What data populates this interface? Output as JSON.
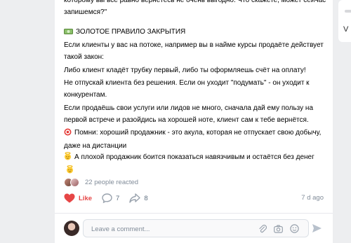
{
  "post": {
    "lines": [
      "которому вы всё равно вернётесь не очень выгодно. Что скажете, может сейчас запишемся?\"",
      "ЗОЛОТОЕ ПРАВИЛО ЗАКРЫТИЯ",
      "Если клиенты у вас на потоке, например вы в найме курсы продаёте действует такой закон:",
      "Либо клиент кладёт трубку первый, либо ты оформляешь счёт на оплату!",
      "Не отпускай клиента без решения. Если он уходит \"подумать\" - он уходит к конкурентам.",
      "Если продаёшь свои услуги или лидов не много, сначала дай ему пользу на первой встрече и разойдись на хорошей ноте, клиент сам к тебе вернётся.",
      "Помни: хороший продажник - это акула, которая не отпускает свою добычу, даже на дистанции",
      "А плохой продажник боится показаться навязчивым и остаётся без денег"
    ],
    "icons": [
      "money-icon",
      "target-icon",
      "angel-icon"
    ]
  },
  "reactions": {
    "count_text": "22 people reacted"
  },
  "actions": {
    "like_label": "Like",
    "comments_count": "7",
    "shares_count": "8",
    "date": "7 d ago"
  },
  "comment": {
    "placeholder": "Leave a comment..."
  },
  "side": {
    "letter": "V"
  },
  "colors": {
    "like": "#e64646",
    "muted": "#818c99",
    "icon": "#99a2ad"
  }
}
